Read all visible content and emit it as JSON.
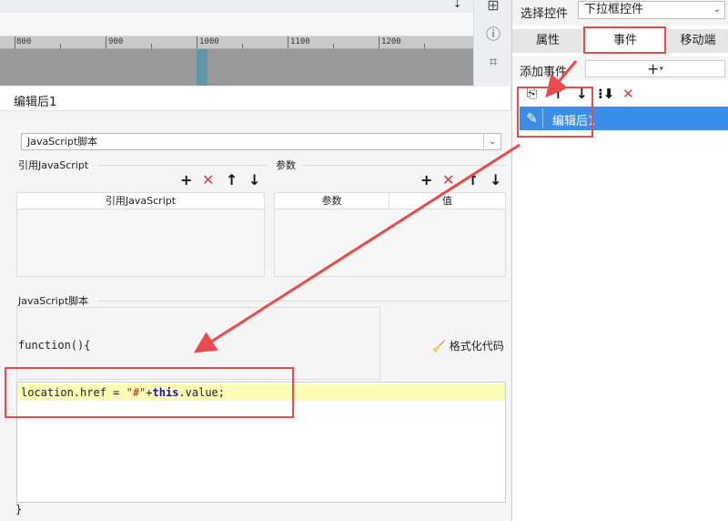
{
  "ruler": {
    "marks": [
      "800",
      "900",
      "1000",
      "1100",
      "1200"
    ]
  },
  "right_panel": {
    "select_label": "选择控件",
    "selected_widget": "下拉框控件",
    "tabs": [
      "属性",
      "事件",
      "移动端"
    ],
    "add_event_label": "添加事件",
    "event_item_label": "编辑后1"
  },
  "dialog": {
    "title": "编辑后1",
    "script_type": "JavaScript脚本",
    "ref_js_label": "引用JavaScript",
    "ref_js_column": "引用JavaScript",
    "params_label": "参数",
    "params_columns": [
      "参数",
      "值"
    ],
    "script_section_label": "JavaScript脚本",
    "function_open": "function(){",
    "format_button_label": "格式化代码",
    "function_close": "}"
  },
  "colors": {
    "accent": "#3b8ee8",
    "annotation_red": "#e84c4c",
    "highlight_line": "#fcfcb6"
  }
}
